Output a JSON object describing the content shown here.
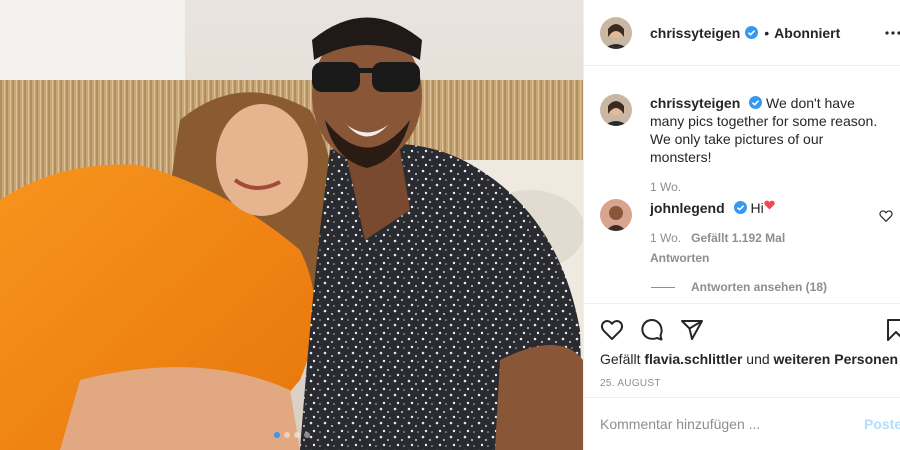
{
  "post": {
    "author": "chrissyteigen",
    "follow_status": "Abonniert",
    "separator": "•",
    "more_icon": "more-horizontal-icon",
    "verified_color": "#3897f0"
  },
  "caption": {
    "user": "chrissyteigen",
    "text": "We don't have many pics together for some reason. We only take pictures of our monsters!",
    "age": "1 Wo."
  },
  "comment": {
    "user": "johnlegend",
    "text": "Hi",
    "age": "1 Wo.",
    "likes": "Gefällt 1.192 Mal",
    "reply": "Antworten",
    "heart_color": "#ed4956"
  },
  "view_replies": "Antworten ansehen (18)",
  "likes_line": {
    "prefix": "Gefällt",
    "user": "flavia.schlittler",
    "middle": "und",
    "suffix": "weiteren Personen"
  },
  "date": "25. AUGUST",
  "comment_bar": {
    "placeholder": "Kommentar hinzufügen ...",
    "post_label": "Posten"
  },
  "carousel": {
    "count": 4,
    "active": 1
  },
  "colors": {
    "accent": "#3897f0",
    "post_button_disabled": "#b2dffc",
    "secondary_text": "#8e8e8e",
    "border": "#efefef"
  }
}
